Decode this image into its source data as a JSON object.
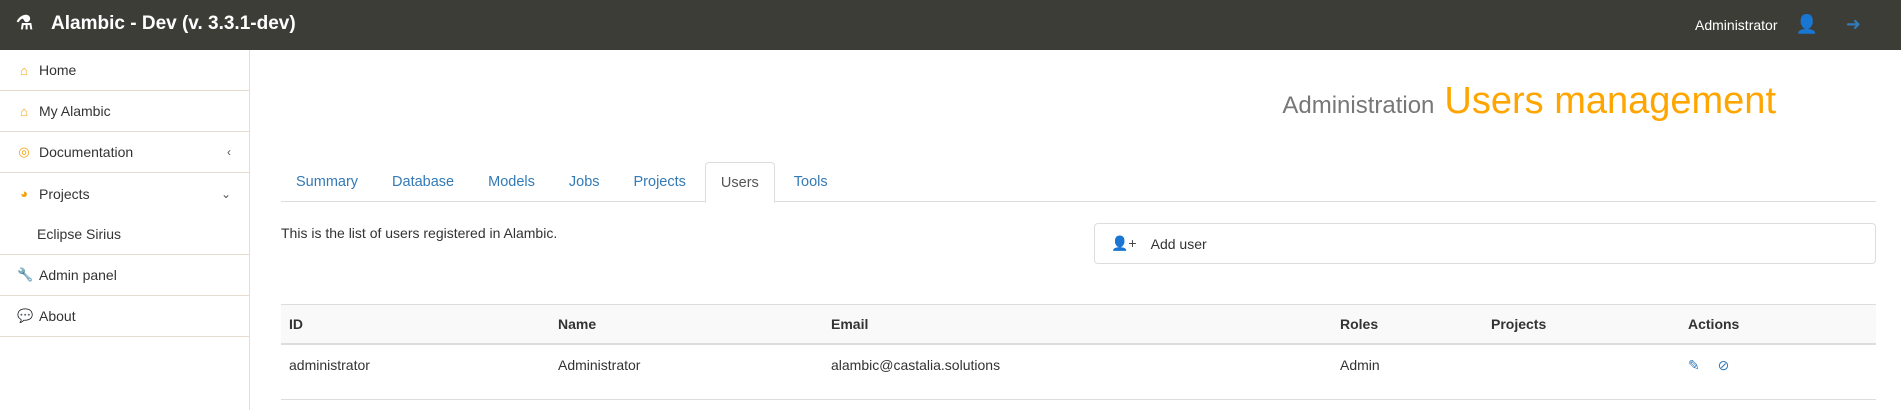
{
  "navbar": {
    "title": "Alambic - Dev (v. 3.3.1-dev)",
    "user": "Administrator"
  },
  "sidebar": {
    "items": [
      {
        "label": "Home",
        "icon": "home-icon"
      },
      {
        "label": "My Alambic",
        "icon": "home-icon"
      },
      {
        "label": "Documentation",
        "icon": "life-ring-icon"
      },
      {
        "label": "Projects",
        "icon": "dashboard-icon"
      },
      {
        "label": "Eclipse Sirius"
      },
      {
        "label": "Admin panel",
        "icon": "wrench-icon"
      },
      {
        "label": "About",
        "icon": "comment-icon"
      }
    ]
  },
  "header": {
    "section": "Administration",
    "title": "Users management"
  },
  "tabs": [
    "Summary",
    "Database",
    "Models",
    "Jobs",
    "Projects",
    "Users",
    "Tools"
  ],
  "description": "This is the list of users registered in Alambic.",
  "add_user": "Add user",
  "table": {
    "headers": [
      "ID",
      "Name",
      "Email",
      "Roles",
      "Projects",
      "Actions"
    ],
    "rows": [
      {
        "id": "administrator",
        "name": "Administrator",
        "email": "alambic@castalia.solutions",
        "roles": "Admin",
        "projects": ""
      }
    ]
  }
}
